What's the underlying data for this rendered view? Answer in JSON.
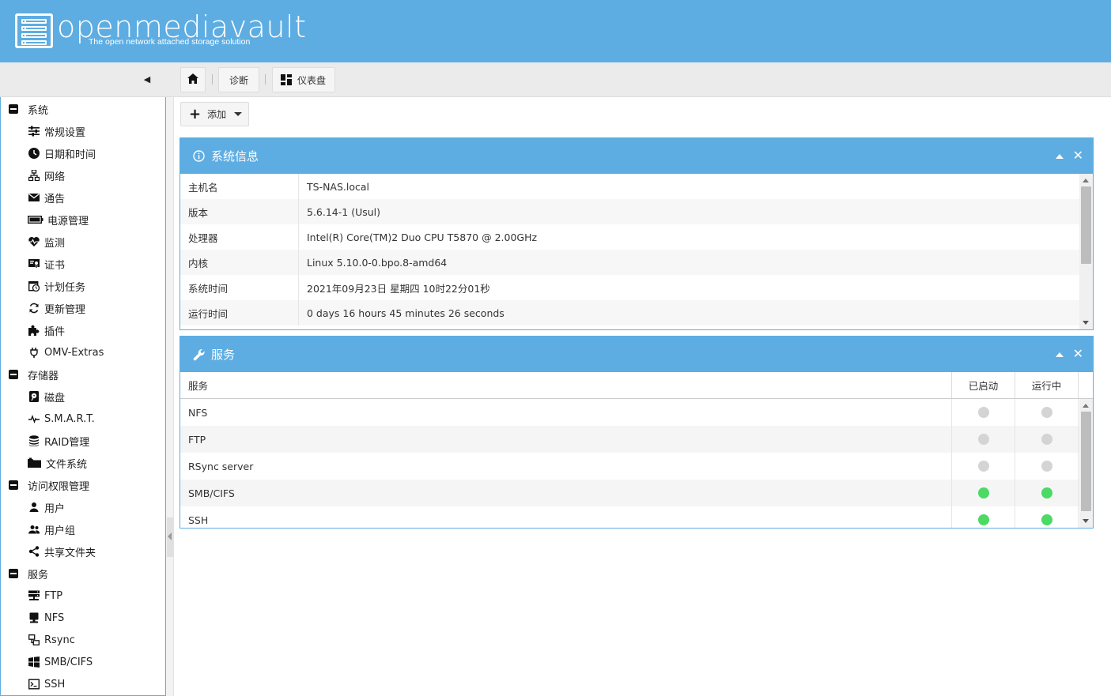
{
  "app": {
    "name": "openmediavault",
    "tagline": "The open network attached storage solution"
  },
  "breadcrumb": {
    "home": "home-icon",
    "items": [
      "诊断",
      "仪表盘"
    ]
  },
  "toolbar": {
    "add_label": "添加"
  },
  "sidebar": {
    "groups": [
      {
        "label": "系统",
        "items": [
          {
            "label": "常规设置",
            "icon": "sliders-icon"
          },
          {
            "label": "日期和时间",
            "icon": "clock-icon"
          },
          {
            "label": "网络",
            "icon": "network-icon"
          },
          {
            "label": "通告",
            "icon": "envelope-icon"
          },
          {
            "label": "电源管理",
            "icon": "battery-icon"
          },
          {
            "label": "监测",
            "icon": "heartbeat-icon"
          },
          {
            "label": "证书",
            "icon": "certificate-icon"
          },
          {
            "label": "计划任务",
            "icon": "calendar-clock-icon"
          },
          {
            "label": "更新管理",
            "icon": "refresh-icon"
          },
          {
            "label": "插件",
            "icon": "puzzle-icon"
          },
          {
            "label": "OMV-Extras",
            "icon": "plug-icon"
          }
        ]
      },
      {
        "label": "存储器",
        "items": [
          {
            "label": "磁盘",
            "icon": "harddisk-icon"
          },
          {
            "label": "S.M.A.R.T.",
            "icon": "pulse-icon"
          },
          {
            "label": "RAID管理",
            "icon": "database-icon"
          },
          {
            "label": "文件系统",
            "icon": "folder-icon"
          }
        ]
      },
      {
        "label": "访问权限管理",
        "items": [
          {
            "label": "用户",
            "icon": "user-icon"
          },
          {
            "label": "用户组",
            "icon": "users-icon"
          },
          {
            "label": "共享文件夹",
            "icon": "share-icon"
          }
        ]
      },
      {
        "label": "服务",
        "items": [
          {
            "label": "FTP",
            "icon": "server-icon"
          },
          {
            "label": "NFS",
            "icon": "desktop-icon"
          },
          {
            "label": "Rsync",
            "icon": "sync-network-icon"
          },
          {
            "label": "SMB/CIFS",
            "icon": "windows-icon"
          },
          {
            "label": "SSH",
            "icon": "terminal-icon"
          }
        ]
      }
    ]
  },
  "sysinfo": {
    "title": "系统信息",
    "rows": [
      {
        "key": "主机名",
        "value": "TS-NAS.local"
      },
      {
        "key": "版本",
        "value": "5.6.14-1 (Usul)"
      },
      {
        "key": "处理器",
        "value": "Intel(R) Core(TM)2 Duo CPU T5870 @ 2.00GHz"
      },
      {
        "key": "内核",
        "value": "Linux 5.10.0-0.bpo.8-amd64"
      },
      {
        "key": "系统时间",
        "value": "2021年09月23日 星期四 10时22分01秒"
      },
      {
        "key": "运行时间",
        "value": "0 days 16 hours 45 minutes 26 seconds"
      }
    ]
  },
  "services": {
    "title": "服务",
    "columns": [
      "服务",
      "已启动",
      "运行中"
    ],
    "rows": [
      {
        "name": "NFS",
        "enabled": false,
        "running": false
      },
      {
        "name": "FTP",
        "enabled": false,
        "running": false
      },
      {
        "name": "RSync server",
        "enabled": false,
        "running": false
      },
      {
        "name": "SMB/CIFS",
        "enabled": true,
        "running": true
      },
      {
        "name": "SSH",
        "enabled": true,
        "running": true
      }
    ]
  },
  "colors": {
    "accent": "#5dade2",
    "status_on": "#4cd964",
    "status_off": "#d4d4d4"
  }
}
